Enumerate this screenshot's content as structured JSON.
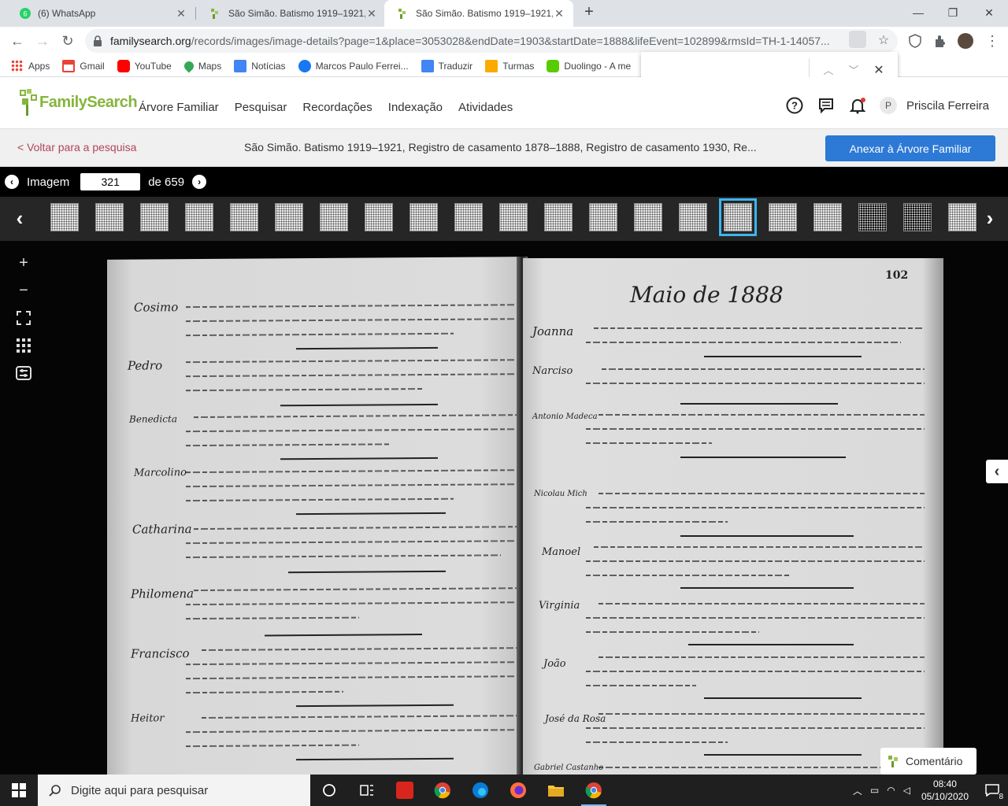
{
  "browser": {
    "tabs": [
      {
        "title": "(6) WhatsApp",
        "icon": "whatsapp-icon"
      },
      {
        "title": "São Simão. Batismo 1919–1921, R",
        "icon": "familysearch-icon"
      },
      {
        "title": "São Simão. Batismo 1919–1921, R",
        "icon": "familysearch-icon"
      }
    ],
    "url_host": "familysearch.org",
    "url_path": "/records/images/image-details?page=1&place=3053028&endDate=1903&startDate=1888&lifeEvent=102899&rmsId=TH-1-14057...",
    "bookmarks": [
      {
        "label": "Apps",
        "color": "#4285f4"
      },
      {
        "label": "Gmail",
        "color": "#ea4335"
      },
      {
        "label": "YouTube",
        "color": "#ff0000"
      },
      {
        "label": "Maps",
        "color": "#34a853"
      },
      {
        "label": "Notícias",
        "color": "#4285f4"
      },
      {
        "label": "Marcos Paulo Ferrei...",
        "color": "#1877f2"
      },
      {
        "label": "Traduzir",
        "color": "#4285f4"
      },
      {
        "label": "Turmas",
        "color": "#f9ab00"
      },
      {
        "label": "Duolingo - A me",
        "color": "#58cc02"
      }
    ],
    "find_value": ""
  },
  "header": {
    "logo": "FamilySearch",
    "nav": [
      "Árvore Familiar",
      "Pesquisar",
      "Recordações",
      "Indexação",
      "Atividades"
    ],
    "avatar_letter": "P",
    "user_name": "Priscila Ferreira"
  },
  "subheader": {
    "back": "< Voltar para a pesquisa",
    "title": "São Simão. Batismo 1919–1921, Registro de casamento 1878–1888, Registro de casamento 1930, Re...",
    "attach": "Anexar à Árvore Familiar"
  },
  "imagebar": {
    "label": "Imagem",
    "current": "321",
    "of_label": "de 659"
  },
  "record": {
    "page_heading": "Maio de 1888",
    "page_number": "102",
    "left_names": [
      "Cosimo",
      "Pedro",
      "Benedicta",
      "Marcolino",
      "Catharina",
      "Philomena",
      "Francisco",
      "Heitor"
    ],
    "right_names": [
      "Joanna",
      "Narciso",
      "Antonio Madeca",
      "Nicolau Mich",
      "Manoel",
      "Virginia",
      "João",
      "José da Rosa",
      "Gabriel Castanho"
    ]
  },
  "viewer": {
    "comment": "Comentário"
  },
  "taskbar": {
    "search_placeholder": "Digite aqui para pesquisar",
    "time": "08:40",
    "date": "05/10/2020",
    "notifications": "8"
  }
}
